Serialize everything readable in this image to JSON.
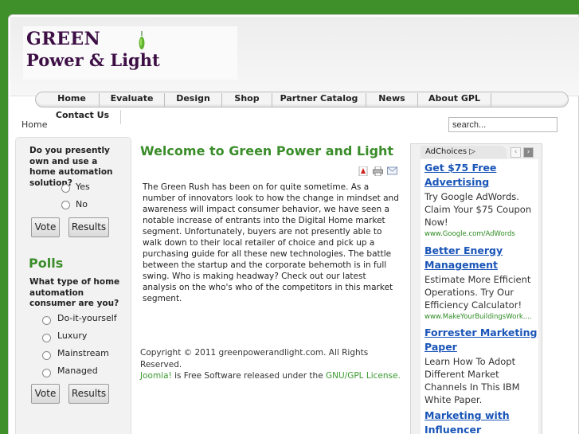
{
  "logo": {
    "line1": "GREEN",
    "line2": "Power & Light"
  },
  "nav": {
    "items": [
      "Home",
      "Evaluate",
      "Design",
      "Shop",
      "Partner Catalog",
      "News",
      "About GPL"
    ],
    "second_row": [
      "Contact Us"
    ]
  },
  "breadcrumb": "Home",
  "search": {
    "value": "search..."
  },
  "poll1": {
    "question": "Do you presently own and use a home automation solution?",
    "options": [
      "Yes",
      "No"
    ],
    "vote": "Vote",
    "results": "Results"
  },
  "polls_heading": "Polls",
  "poll2": {
    "question": "What type of home automation consumer are you?",
    "options": [
      "Do-it-yourself",
      "Luxury",
      "Mainstream",
      "Managed"
    ],
    "vote": "Vote",
    "results": "Results"
  },
  "article": {
    "title": "Welcome to Green Power and Light",
    "icons": [
      "pdf-icon",
      "print-icon",
      "email-icon"
    ],
    "body": "The Green Rush has been on for quite sometime.  As a number of innovators look to how the change in mindset and awareness will impact consumer behavior, we have seen a notable increase of entrants into the Digital Home market segment.  Unfortunately, buyers are not presently able to walk down to their local retailer of choice and pick up a purchasing guide for all these new technologies.  The battle between the startup and the corporate behemoth is in full swing.  Who is making headway?  Check out our latest analysis on the who's who of the competitors in this market segment."
  },
  "footer": {
    "copyright": "Copyright © 2011 greenpowerandlight.com. All Rights Reserved.",
    "joomla": "Joomla!",
    "middle": " is Free Software released under the ",
    "license": "GNU/GPL License."
  },
  "ads": {
    "label": "AdChoices",
    "items": [
      {
        "title": "Get $75 Free Advertising",
        "desc": "Try Google AdWords. Claim Your $75 Coupon Now!",
        "url": "www.Google.com/AdWords"
      },
      {
        "title": "Better Energy Management",
        "desc": "Estimate More Efficient Operations. Try Our Efficiency Calculator!",
        "url": "www.MakeYourBuildingsWork...."
      },
      {
        "title": "Forrester Marketing Paper",
        "desc": "Learn How To Adopt Different Market Channels In This IBM White Paper.",
        "url": ""
      },
      {
        "title": "Marketing with Influencer",
        "desc": "",
        "url": ""
      }
    ]
  },
  "colors": {
    "background": "#3f8f2a",
    "accent": "#3a8d2a",
    "link": "#1a55b8",
    "logo": "#3d0f45"
  }
}
